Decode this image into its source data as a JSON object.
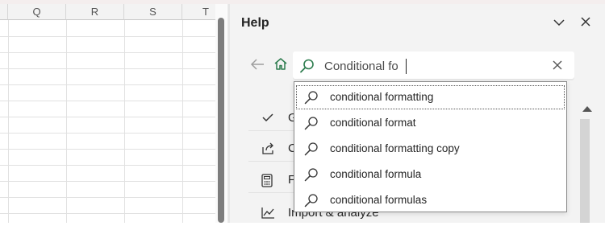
{
  "sheet": {
    "columns": [
      "Q",
      "R",
      "S",
      "T"
    ]
  },
  "help": {
    "title": "Help",
    "search": {
      "value": "Conditional fo",
      "placeholder": ""
    },
    "suggestions": [
      {
        "label": "conditional formatting",
        "icon": "search-icon"
      },
      {
        "label": "conditional format",
        "icon": "search-icon"
      },
      {
        "label": "conditional formatting copy",
        "icon": "search-icon"
      },
      {
        "label": "conditional formula",
        "icon": "search-icon"
      },
      {
        "label": "conditional formulas",
        "icon": "search-icon"
      }
    ],
    "topics": [
      {
        "label": "G",
        "icon": "checkmark-icon"
      },
      {
        "label": "C",
        "icon": "share-icon"
      },
      {
        "label": "F",
        "icon": "calculator-icon"
      },
      {
        "label": "Import & analyze",
        "icon": "chart-icon"
      }
    ]
  },
  "colors": {
    "accent_green": "#2e7d4f",
    "pane_bg": "#f3f3f3"
  }
}
